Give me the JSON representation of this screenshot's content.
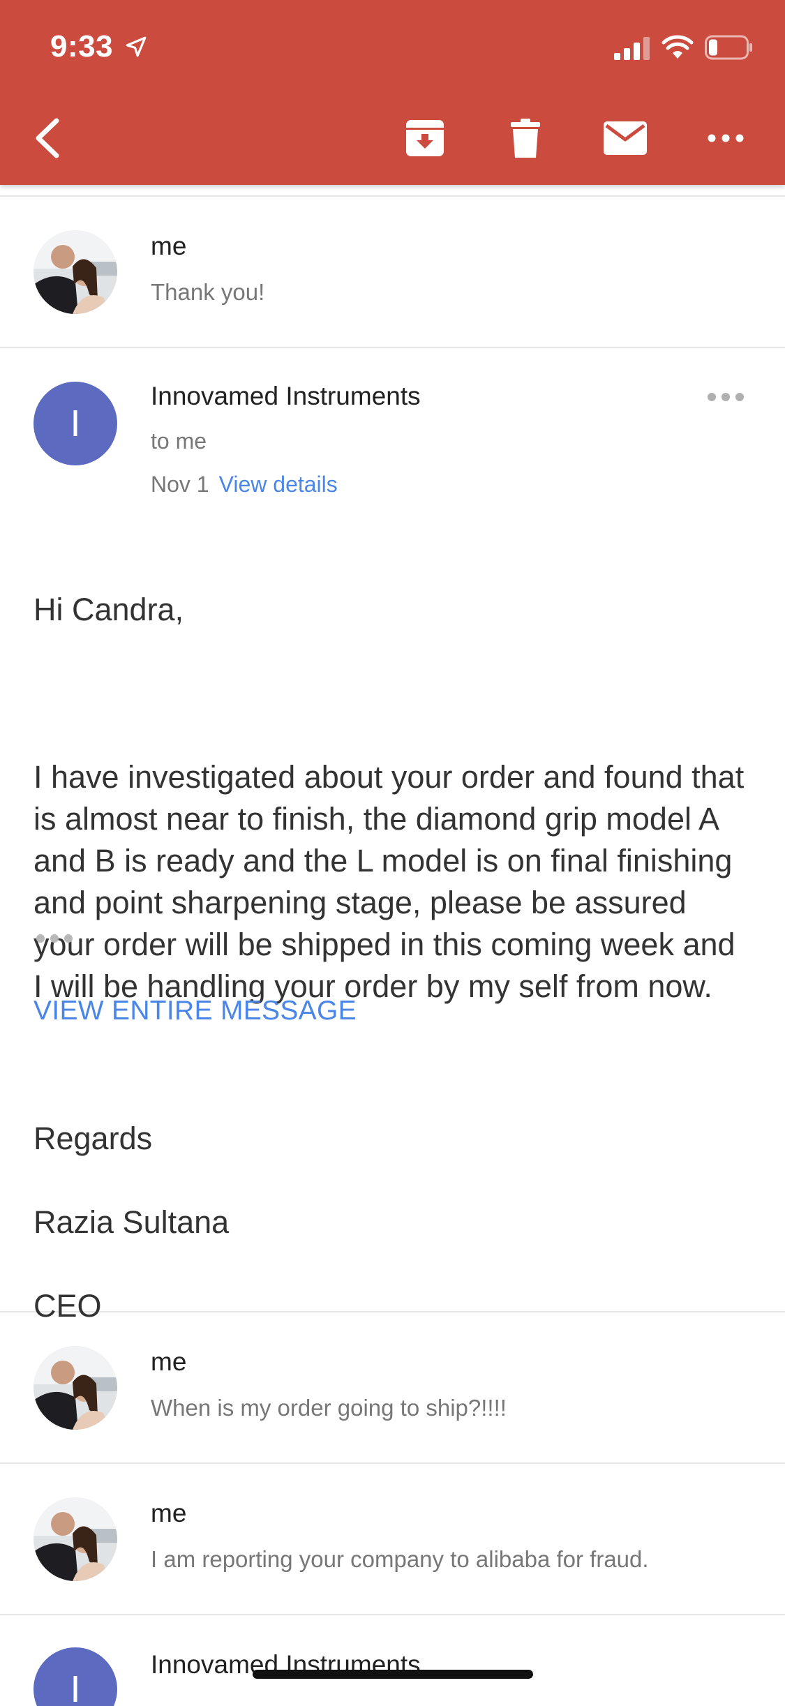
{
  "status_bar": {
    "time": "9:33"
  },
  "toolbar": {
    "icons": [
      "back-arrow-icon",
      "archive-icon",
      "trash-icon",
      "mail-icon",
      "more-horizontal-icon"
    ],
    "color": "#cb4b3f"
  },
  "thread": {
    "messages": [
      {
        "sender": "me",
        "snippet": "Thank you!"
      },
      {
        "sender": "Innovamed Instruments",
        "avatar_letter": "I",
        "avatar_color": "#5c6bc0",
        "recipient": "to me",
        "date": "Nov 1",
        "view_details": "View details",
        "greeting": "Hi Candra,",
        "body": "I have investigated about your order and found that is almost near to finish, the diamond grip model A and B is ready and the L model is on final finishing and point sharpening stage, please be assured your order will be shipped in this coming week and I will be handling your order by my self from now.",
        "closing": "Regards",
        "signature_name": "Razia Sultana",
        "signature_title": "CEO",
        "view_entire": "VIEW ENTIRE MESSAGE"
      },
      {
        "sender": "me",
        "snippet": "When is my order going to ship?!!!!"
      },
      {
        "sender": "me",
        "snippet": "I am reporting your company to alibaba for fraud."
      },
      {
        "sender": "Innovamed Instruments",
        "avatar_letter": "I"
      }
    ]
  }
}
